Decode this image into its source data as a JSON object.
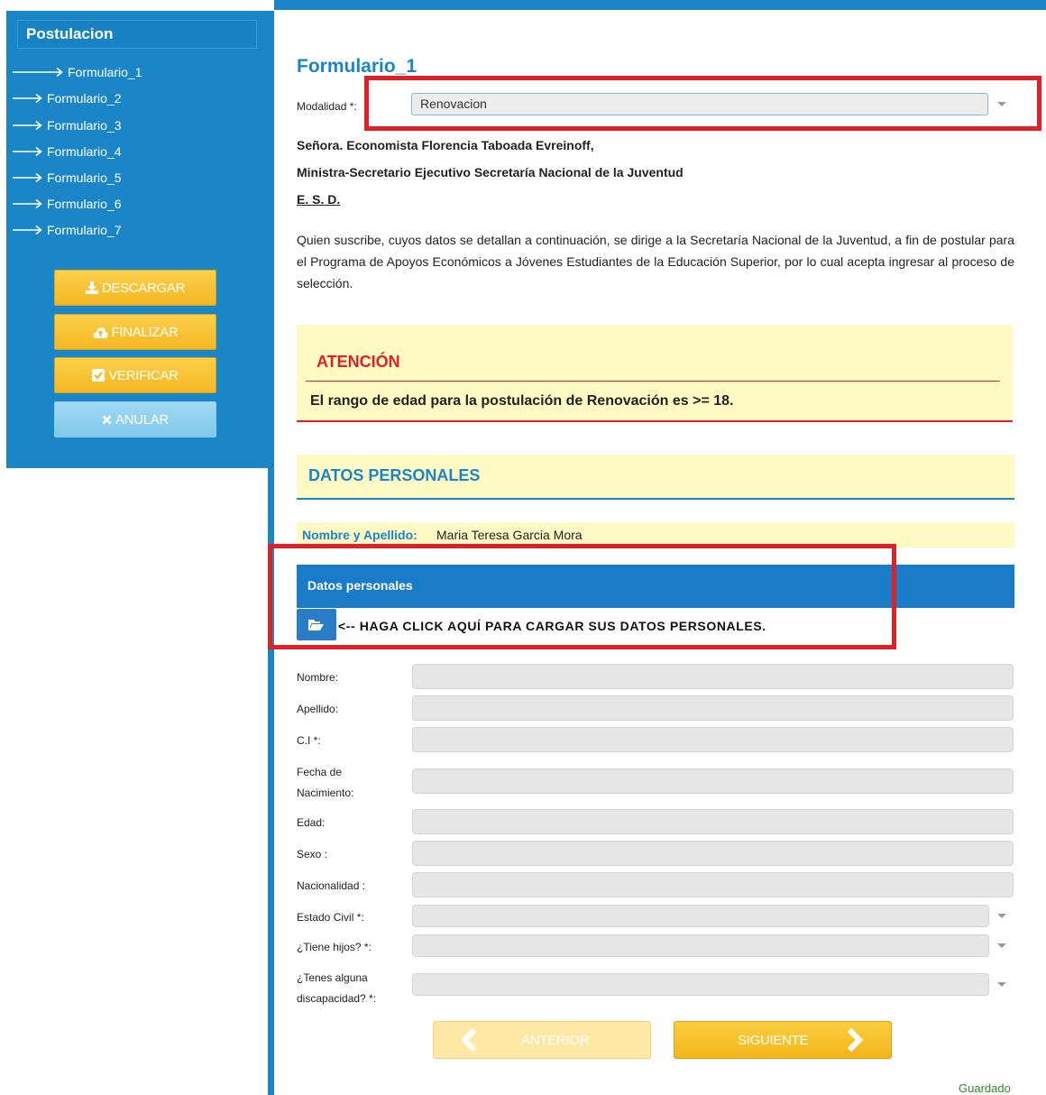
{
  "sidebar": {
    "title": "Postulacion",
    "items": [
      {
        "label": "Formulario_1"
      },
      {
        "label": "Formulario_2"
      },
      {
        "label": "Formulario_3"
      },
      {
        "label": "Formulario_4"
      },
      {
        "label": "Formulario_5"
      },
      {
        "label": "Formulario_6"
      },
      {
        "label": "Formulario_7"
      }
    ],
    "buttons": {
      "descargar": "DESCARGAR",
      "finalizar": "FINALIZAR",
      "verificar": "VERIFICAR",
      "anular": "ANULAR"
    }
  },
  "form": {
    "title": "Formulario_1",
    "modalidad_label": "Modalidad *:",
    "modalidad_value": "Renovacion",
    "addressee_line1": "Señora. Economista Florencia Taboada Evreinoff,",
    "addressee_line2": "Ministra-Secretario Ejecutivo Secretaría Nacional de la Juventud",
    "esd": "E. S. D.",
    "intro": "Quien suscribe, cuyos datos se detallan a continuación, se dirige a la Secretaría Nacional de la Juventud, a fin de postular para el Programa de Apoyos Económicos a Jóvenes Estudiantes de la Educación Superior, por lo cual acepta ingresar al proceso de selección."
  },
  "attention": {
    "title": "ATENCIÓN",
    "message": "El rango de edad para la postulación de Renovación es >= 18."
  },
  "personal": {
    "section_title": "DATOS PERSONALES",
    "name_label": "Nombre y Apellido:",
    "name_value": "Maria Teresa Garcia Mora",
    "bar_title": "Datos personales",
    "load_hint": "<-- HAGA CLICK AQUÍ PARA CARGAR SUS DATOS PERSONALES."
  },
  "fields": {
    "nombre": "Nombre:",
    "apellido": "Apellido:",
    "ci": "C.I *:",
    "fecha_nacimiento": "Fecha de Nacimiento:",
    "edad": "Edad:",
    "sexo": "Sexo :",
    "nacionalidad": "Nacionalidad :",
    "estado_civil": "Estado Civil *:",
    "tiene_hijos": "¿Tiene hijos? *:",
    "discapacidad": "¿Tenes alguna discapacidad? *:"
  },
  "nav": {
    "prev": "ANTERIOR",
    "next": "SIGUIENTE"
  },
  "status": {
    "saved": "Guardado"
  },
  "colors": {
    "primary_blue": "#1a86c7",
    "accent_yellow": "#f4b721",
    "highlight_red": "#e02027",
    "notice_bg": "#fff9c4"
  }
}
